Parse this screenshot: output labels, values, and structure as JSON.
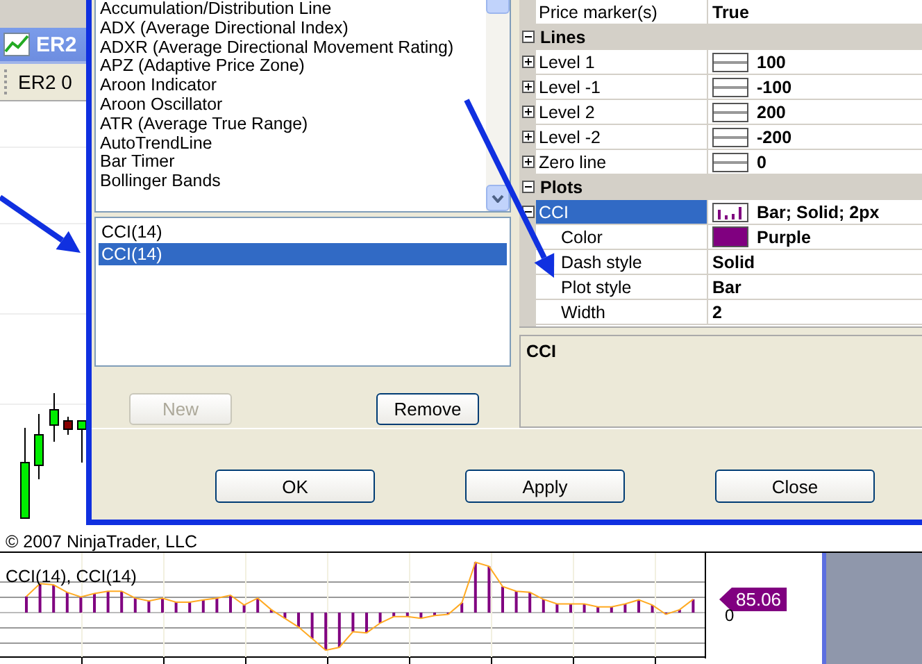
{
  "chart_window": {
    "title": "ER2",
    "toolbar_label": "ER2 0",
    "copyright": "© 2007 NinjaTrader, LLC",
    "indicator_panel": {
      "label": "CCI(14), CCI(14)",
      "price_tag": "85.06",
      "axis_label": "0"
    }
  },
  "dialog": {
    "indicators": [
      "Accumulation/Distribution Line",
      "ADX (Average Directional Index)",
      "ADXR (Average Directional Movement Rating)",
      "APZ (Adaptive Price Zone)",
      "Aroon Indicator",
      "Aroon Oscillator",
      "ATR (Average True Range)",
      "AutoTrendLine",
      "Bar Timer",
      "Bollinger Bands"
    ],
    "applied": [
      {
        "label": "CCI(14)",
        "selected": false
      },
      {
        "label": "CCI(14)",
        "selected": true
      }
    ],
    "list_buttons": [
      {
        "label": "New",
        "disabled": true
      },
      {
        "label": "Remove",
        "disabled": false
      }
    ],
    "properties": [
      {
        "kind": "row",
        "label": "Price marker(s)",
        "value": "True",
        "selected": false
      },
      {
        "kind": "category",
        "label": "Lines",
        "expanded": true,
        "children": [
          {
            "label": "Level 1",
            "value": "100",
            "kind": "line",
            "expanded": false,
            "selected": false
          },
          {
            "label": "Level -1",
            "value": "-100",
            "kind": "line",
            "expanded": false,
            "selected": false
          },
          {
            "label": "Level 2",
            "value": "200",
            "kind": "line",
            "expanded": false,
            "selected": false
          },
          {
            "label": "Level -2",
            "value": "-200",
            "kind": "line",
            "expanded": false,
            "selected": false
          },
          {
            "label": "Zero line",
            "value": "0",
            "kind": "line",
            "expanded": false,
            "selected": false
          }
        ]
      },
      {
        "kind": "category",
        "label": "Plots",
        "expanded": true,
        "children": [
          {
            "label": "CCI",
            "value": "Bar; Solid; 2px",
            "kind": "bar",
            "expanded": true,
            "selected": true,
            "children": [
              {
                "label": "Color",
                "value": "Purple",
                "color": "#800080",
                "selected": false
              },
              {
                "label": "Dash style",
                "value": "Solid",
                "selected": false
              },
              {
                "label": "Plot style",
                "value": "Bar",
                "selected": false
              },
              {
                "label": "Width",
                "value": "2",
                "selected": false
              }
            ]
          }
        ]
      }
    ],
    "description": "CCI",
    "footer_buttons": [
      "OK",
      "Apply",
      "Close"
    ]
  }
}
